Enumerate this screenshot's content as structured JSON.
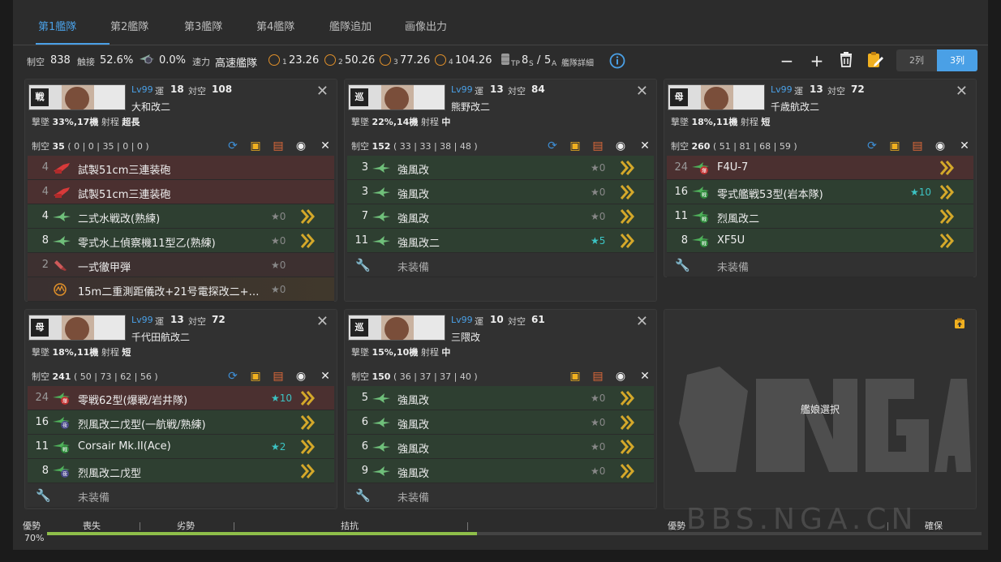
{
  "tabs": [
    "第1艦隊",
    "第2艦隊",
    "第3艦隊",
    "第4艦隊",
    "艦隊追加",
    "画像出力"
  ],
  "stats": {
    "air_lbl": "制空",
    "air_val": "838",
    "contact_lbl": "触接",
    "contact_val": "52.6%",
    "night_val": "0.0%",
    "speed_lbl": "速力",
    "speed_val": "高速艦隊",
    "los1": "1",
    "los1_val": "23.26",
    "los2": "2",
    "los2_val": "50.26",
    "los3": "3",
    "los3_val": "77.26",
    "los4": "4",
    "los4_val": "104.26",
    "tp_main": "8",
    "tp_sub": "TP",
    "tp_s": "S",
    "slash": "/",
    "a_main": "5",
    "a_sub": "A",
    "detail": "艦隊詳細"
  },
  "toolbar": {
    "minus": "−",
    "plus": "+",
    "cols2": "2列",
    "cols3": "3列"
  },
  "labels": {
    "lv": "Lv99",
    "luck": "運",
    "aa": "対空",
    "shootdown": "撃墜",
    "range": "射程",
    "air": "制空",
    "none": "未装備"
  },
  "ships": [
    {
      "badge": "戦",
      "name": "大和改二",
      "luck": "18",
      "aa": "108",
      "shootdown": "33%,17機",
      "range": "超長",
      "air": "35",
      "air_detail": "( 0 | 0 | 35 | 0 | 0 )",
      "slots": [
        {
          "count": "4",
          "name": "試製51cm三連装砲",
          "star": ""
        },
        {
          "count": "4",
          "name": "試製51cm三連装砲",
          "star": ""
        },
        {
          "count": "4",
          "name": "二式水戦改(熟練)",
          "star": "★0"
        },
        {
          "count": "8",
          "name": "零式水上偵察機11型乙(熟練)",
          "star": "★0"
        },
        {
          "count": "2",
          "name": "一式徹甲弾",
          "star": "★0"
        },
        {
          "count": "",
          "name": "15m二重測距儀改+21号電探改二+…",
          "star": "★0"
        }
      ]
    },
    {
      "badge": "巡",
      "name": "熊野改二",
      "luck": "13",
      "aa": "84",
      "shootdown": "22%,14機",
      "range": "中",
      "air": "152",
      "air_detail": "( 33 | 33 | 38 | 48 )",
      "slots": [
        {
          "count": "3",
          "name": "強風改",
          "star": "★0"
        },
        {
          "count": "3",
          "name": "強風改",
          "star": "★0"
        },
        {
          "count": "7",
          "name": "強風改",
          "star": "★0"
        },
        {
          "count": "11",
          "name": "強風改二",
          "star": "★5"
        }
      ]
    },
    {
      "badge": "母",
      "name": "千歳航改二",
      "luck": "13",
      "aa": "72",
      "shootdown": "18%,11機",
      "range": "短",
      "air": "260",
      "air_detail": "( 51 | 81 | 68 | 59 )",
      "slots": [
        {
          "count": "24",
          "name": "F4U-7",
          "star": "",
          "tag": "爆"
        },
        {
          "count": "16",
          "name": "零式艦戦53型(岩本隊)",
          "star": "★10",
          "tag": "戦"
        },
        {
          "count": "11",
          "name": "烈風改二",
          "star": "",
          "tag": "戦"
        },
        {
          "count": "8",
          "name": "XF5U",
          "star": "",
          "tag": "戦"
        }
      ]
    },
    {
      "badge": "母",
      "name": "千代田航改二",
      "luck": "13",
      "aa": "72",
      "shootdown": "18%,11機",
      "range": "短",
      "air": "241",
      "air_detail": "( 50 | 73 | 62 | 56 )",
      "slots": [
        {
          "count": "24",
          "name": "零戦62型(爆戦/岩井隊)",
          "star": "★10",
          "tag": "爆"
        },
        {
          "count": "16",
          "name": "烈風改二戊型(一航戦/熟練)",
          "star": "",
          "tag": "夜戦"
        },
        {
          "count": "11",
          "name": "Corsair Mk.II(Ace)",
          "star": "★2",
          "tag": "戦"
        },
        {
          "count": "8",
          "name": "烈風改二戊型",
          "star": "",
          "tag": "夜戦"
        }
      ]
    },
    {
      "badge": "巡",
      "name": "三隈改",
      "luck": "10",
      "aa": "61",
      "shootdown": "15%,10機",
      "range": "中",
      "air": "150",
      "air_detail": "( 36 | 37 | 37 | 40 )",
      "slots": [
        {
          "count": "5",
          "name": "強風改",
          "star": "★0"
        },
        {
          "count": "6",
          "name": "強風改",
          "star": "★0"
        },
        {
          "count": "6",
          "name": "強風改",
          "star": "★0"
        },
        {
          "count": "9",
          "name": "強風改",
          "star": "★0"
        }
      ]
    }
  ],
  "empty_slot": "艦娘選択",
  "watermark": "BBS.NGA.CN",
  "air_state": {
    "labels": [
      "優勢",
      "喪失",
      "劣勢",
      "拮抗",
      "優勢",
      "確保"
    ],
    "percent": "70%",
    "fill": 0.46
  },
  "colors": {
    "accent": "#4aa0e6",
    "green": "#8fbf4a",
    "teal": "#3cc4c4",
    "orange": "#f0b020"
  }
}
